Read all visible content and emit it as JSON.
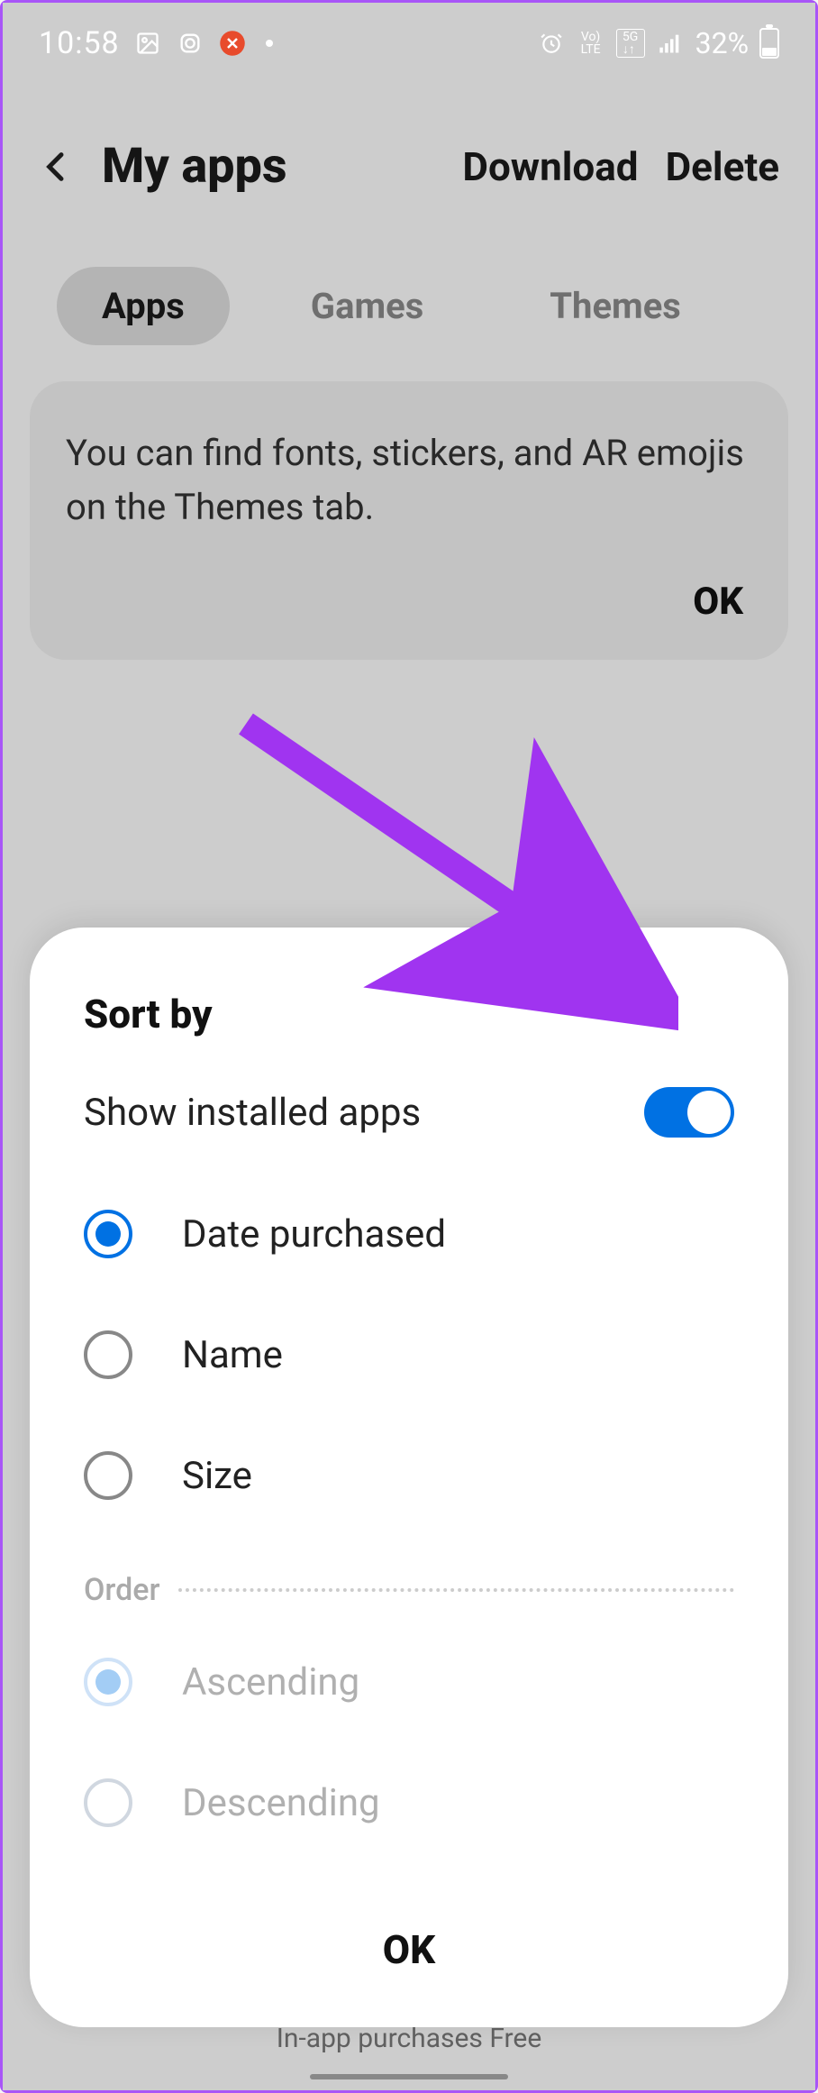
{
  "statusbar": {
    "time": "10:58",
    "battery_pct": "32%"
  },
  "header": {
    "title": "My apps",
    "actions": {
      "download": "Download",
      "delete": "Delete"
    }
  },
  "tabs": {
    "apps": "Apps",
    "games": "Games",
    "themes": "Themes"
  },
  "info_card": {
    "text": "You can find fonts, stickers, and AR emojis on the Themes tab.",
    "ok": "OK"
  },
  "bg_footer": "In-app purchases Free",
  "sheet": {
    "title": "Sort by",
    "toggle_label": "Show installed apps",
    "toggle_on": true,
    "sort_options": [
      {
        "label": "Date purchased",
        "selected": true
      },
      {
        "label": "Name",
        "selected": false
      },
      {
        "label": "Size",
        "selected": false
      }
    ],
    "order_label": "Order",
    "order_options": [
      {
        "label": "Ascending",
        "selected": true
      },
      {
        "label": "Descending",
        "selected": false
      }
    ],
    "ok": "OK"
  },
  "annotation": {
    "color": "#a034f0"
  }
}
